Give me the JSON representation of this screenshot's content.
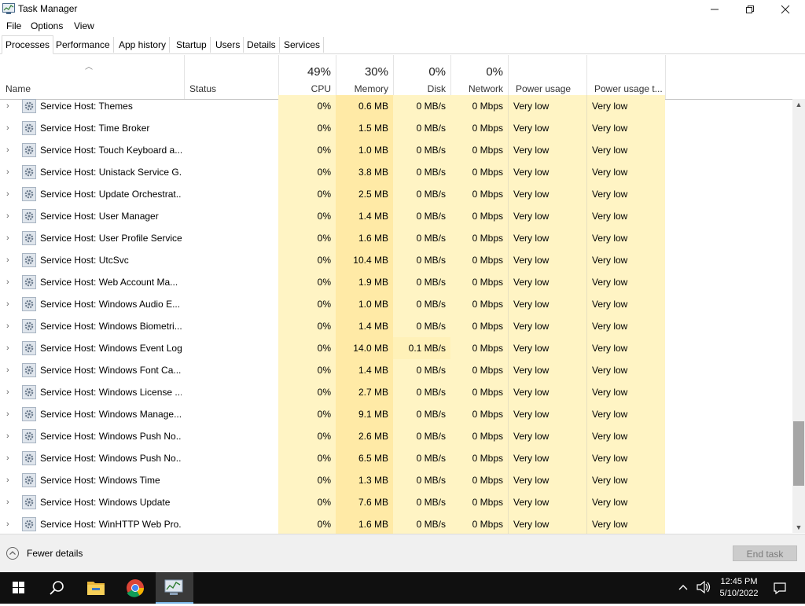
{
  "window": {
    "title": "Task Manager"
  },
  "menu": [
    "File",
    "Options",
    "View"
  ],
  "tabs": [
    "Processes",
    "Performance",
    "App history",
    "Startup",
    "Users",
    "Details",
    "Services"
  ],
  "active_tab": "Processes",
  "columns": {
    "name": "Name",
    "status": "Status",
    "cpu": {
      "pct": "49%",
      "label": "CPU"
    },
    "memory": {
      "pct": "30%",
      "label": "Memory"
    },
    "disk": {
      "pct": "0%",
      "label": "Disk"
    },
    "network": {
      "pct": "0%",
      "label": "Network"
    },
    "power": "Power usage",
    "power_trend": "Power usage t..."
  },
  "rows": [
    {
      "name": "Service Host: Themes",
      "cpu": "0%",
      "memory": "0.6 MB",
      "disk": "0 MB/s",
      "network": "0 Mbps",
      "power": "Very low",
      "power_trend": "Very low"
    },
    {
      "name": "Service Host: Time Broker",
      "cpu": "0%",
      "memory": "1.5 MB",
      "disk": "0 MB/s",
      "network": "0 Mbps",
      "power": "Very low",
      "power_trend": "Very low"
    },
    {
      "name": "Service Host: Touch Keyboard a...",
      "cpu": "0%",
      "memory": "1.0 MB",
      "disk": "0 MB/s",
      "network": "0 Mbps",
      "power": "Very low",
      "power_trend": "Very low"
    },
    {
      "name": "Service Host: Unistack Service G...",
      "cpu": "0%",
      "memory": "3.8 MB",
      "disk": "0 MB/s",
      "network": "0 Mbps",
      "power": "Very low",
      "power_trend": "Very low"
    },
    {
      "name": "Service Host: Update Orchestrat...",
      "cpu": "0%",
      "memory": "2.5 MB",
      "disk": "0 MB/s",
      "network": "0 Mbps",
      "power": "Very low",
      "power_trend": "Very low"
    },
    {
      "name": "Service Host: User Manager",
      "cpu": "0%",
      "memory": "1.4 MB",
      "disk": "0 MB/s",
      "network": "0 Mbps",
      "power": "Very low",
      "power_trend": "Very low"
    },
    {
      "name": "Service Host: User Profile Service",
      "cpu": "0%",
      "memory": "1.6 MB",
      "disk": "0 MB/s",
      "network": "0 Mbps",
      "power": "Very low",
      "power_trend": "Very low"
    },
    {
      "name": "Service Host: UtcSvc",
      "cpu": "0%",
      "memory": "10.4 MB",
      "disk": "0 MB/s",
      "network": "0 Mbps",
      "power": "Very low",
      "power_trend": "Very low"
    },
    {
      "name": "Service Host: Web Account Ma...",
      "cpu": "0%",
      "memory": "1.9 MB",
      "disk": "0 MB/s",
      "network": "0 Mbps",
      "power": "Very low",
      "power_trend": "Very low"
    },
    {
      "name": "Service Host: Windows Audio E...",
      "cpu": "0%",
      "memory": "1.0 MB",
      "disk": "0 MB/s",
      "network": "0 Mbps",
      "power": "Very low",
      "power_trend": "Very low"
    },
    {
      "name": "Service Host: Windows Biometri...",
      "cpu": "0%",
      "memory": "1.4 MB",
      "disk": "0 MB/s",
      "network": "0 Mbps",
      "power": "Very low",
      "power_trend": "Very low"
    },
    {
      "name": "Service Host: Windows Event Log",
      "cpu": "0%",
      "memory": "14.0 MB",
      "disk": "0.1 MB/s",
      "network": "0 Mbps",
      "power": "Very low",
      "power_trend": "Very low"
    },
    {
      "name": "Service Host: Windows Font Ca...",
      "cpu": "0%",
      "memory": "1.4 MB",
      "disk": "0 MB/s",
      "network": "0 Mbps",
      "power": "Very low",
      "power_trend": "Very low"
    },
    {
      "name": "Service Host: Windows License ...",
      "cpu": "0%",
      "memory": "2.7 MB",
      "disk": "0 MB/s",
      "network": "0 Mbps",
      "power": "Very low",
      "power_trend": "Very low"
    },
    {
      "name": "Service Host: Windows Manage...",
      "cpu": "0%",
      "memory": "9.1 MB",
      "disk": "0 MB/s",
      "network": "0 Mbps",
      "power": "Very low",
      "power_trend": "Very low"
    },
    {
      "name": "Service Host: Windows Push No...",
      "cpu": "0%",
      "memory": "2.6 MB",
      "disk": "0 MB/s",
      "network": "0 Mbps",
      "power": "Very low",
      "power_trend": "Very low"
    },
    {
      "name": "Service Host: Windows Push No...",
      "cpu": "0%",
      "memory": "6.5 MB",
      "disk": "0 MB/s",
      "network": "0 Mbps",
      "power": "Very low",
      "power_trend": "Very low"
    },
    {
      "name": "Service Host: Windows Time",
      "cpu": "0%",
      "memory": "1.3 MB",
      "disk": "0 MB/s",
      "network": "0 Mbps",
      "power": "Very low",
      "power_trend": "Very low"
    },
    {
      "name": "Service Host: Windows Update",
      "cpu": "0%",
      "memory": "7.6 MB",
      "disk": "0 MB/s",
      "network": "0 Mbps",
      "power": "Very low",
      "power_trend": "Very low"
    },
    {
      "name": "Service Host: WinHTTP Web Pro...",
      "cpu": "0%",
      "memory": "1.6 MB",
      "disk": "0 MB/s",
      "network": "0 Mbps",
      "power": "Very low",
      "power_trend": "Very low"
    }
  ],
  "footer": {
    "fewer_details": "Fewer details",
    "end_task": "End task"
  },
  "taskbar": {
    "icons": [
      "windows-start-icon",
      "search-icon",
      "file-explorer-icon",
      "chrome-icon",
      "task-manager-icon"
    ],
    "time": "12:45 PM",
    "date": "5/10/2022"
  },
  "colors": {
    "cpu_heat": "#fff4c4",
    "memory_heat": "#ffeaa6",
    "highlight_cell": "#fff1b8",
    "taskbar": "#101010"
  }
}
